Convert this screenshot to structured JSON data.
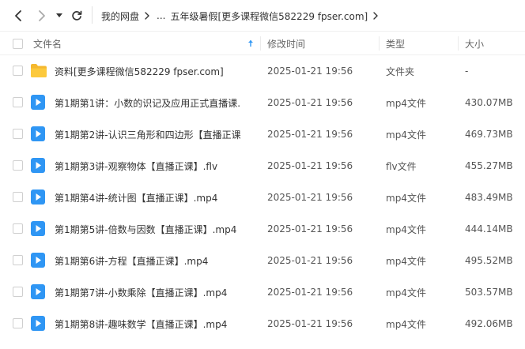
{
  "toolbar": {
    "breadcrumb": [
      "我的网盘",
      "...",
      "五年级暑假[更多课程微信582229 fpser.com]"
    ]
  },
  "columns": {
    "name": "文件名",
    "modified": "修改时间",
    "type": "类型",
    "size": "大小"
  },
  "colors": {
    "accent": "#2f96f4",
    "folder": "#f5b82e"
  },
  "files": [
    {
      "icon": "folder-icon",
      "name": "资料[更多课程微信582229 fpser.com]",
      "date": "2025-01-21 19:56",
      "type": "文件夹",
      "size": "-"
    },
    {
      "icon": "video-file-icon",
      "name": "第1期第1讲：小数的识记及应用正式直播课.",
      "date": "2025-01-21 19:56",
      "type": "mp4文件",
      "size": "430.07MB"
    },
    {
      "icon": "video-file-icon",
      "name": "第1期第2讲-认识三角形和四边形【直播正课",
      "date": "2025-01-21 19:56",
      "type": "mp4文件",
      "size": "469.73MB"
    },
    {
      "icon": "video-file-icon",
      "name": "第1期第3讲-观察物体【直播正课】.flv",
      "date": "2025-01-21 19:56",
      "type": "flv文件",
      "size": "455.27MB"
    },
    {
      "icon": "video-file-icon",
      "name": "第1期第4讲-统计图【直播正课】.mp4",
      "date": "2025-01-21 19:56",
      "type": "mp4文件",
      "size": "483.49MB"
    },
    {
      "icon": "video-file-icon",
      "name": "第1期第5讲-倍数与因数【直播正课】.mp4",
      "date": "2025-01-21 19:56",
      "type": "mp4文件",
      "size": "444.14MB"
    },
    {
      "icon": "video-file-icon",
      "name": "第1期第6讲-方程【直播正课】.mp4",
      "date": "2025-01-21 19:56",
      "type": "mp4文件",
      "size": "495.52MB"
    },
    {
      "icon": "video-file-icon",
      "name": "第1期第7讲-小数乘除【直播正课】.mp4",
      "date": "2025-01-21 19:56",
      "type": "mp4文件",
      "size": "503.57MB"
    },
    {
      "icon": "video-file-icon",
      "name": "第1期第8讲-趣味数学【直播正课】.mp4",
      "date": "2025-01-21 19:56",
      "type": "mp4文件",
      "size": "492.06MB"
    }
  ]
}
